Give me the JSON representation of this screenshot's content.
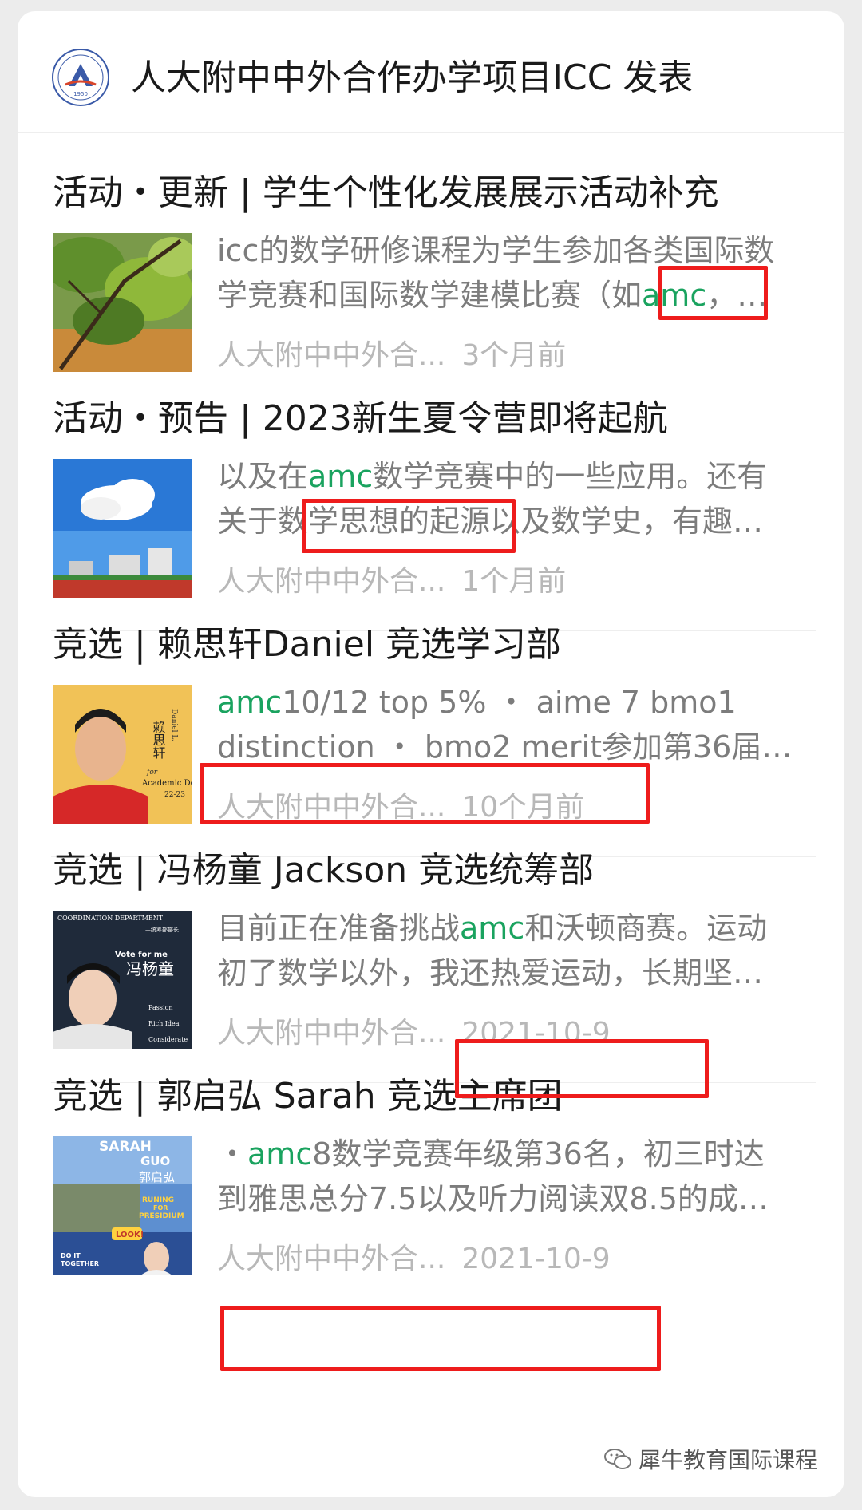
{
  "account": {
    "title": "人大附中中外合作办学项目ICC 发表",
    "logo_year": "1950"
  },
  "articles": [
    {
      "title": "活动・更新 | 学生个性化发展展示活动补充",
      "summary_lines": [
        {
          "pre": "icc的数学研修课程为学生参加各类国际数",
          "hl": "",
          "post": ""
        },
        {
          "pre": "学竞赛和国际数学建模比赛（如",
          "hl": "amc",
          "post": "，…"
        }
      ],
      "source": "人大附中中外合...",
      "time": "3个月前"
    },
    {
      "title": "活动・预告 | 2023新生夏令营即将起航",
      "summary_lines": [
        {
          "pre": "以及在",
          "hl": "amc",
          "post": "数学竞赛中的一些应用。还有"
        },
        {
          "pre": "关于数学思想的起源以及数学史，有趣…",
          "hl": "",
          "post": ""
        }
      ],
      "source": "人大附中中外合...",
      "time": "1个月前"
    },
    {
      "title": "竞选 | 赖思轩Daniel 竞选学习部",
      "summary_lines": [
        {
          "pre": "",
          "hl": "amc",
          "post": "10/12 top 5% ・ aime 7 bmo1"
        },
        {
          "pre": "distinction ・ bmo2 merit参加第36届…",
          "hl": "",
          "post": ""
        }
      ],
      "source": "人大附中中外合...",
      "time": "10个月前",
      "thumb_text": {
        "name": "赖思轩",
        "sign": "Daniel L.",
        "for": "for",
        "dept": "Academic Dept.",
        "year": "22-23"
      }
    },
    {
      "title": "竞选 | 冯杨童 Jackson 竞选统筹部",
      "summary_lines": [
        {
          "pre": "目前正在准备挑战",
          "hl": "amc",
          "post": "和沃顿商赛。运动"
        },
        {
          "pre": "初了数学以外，我还热爱运动，长期坚…",
          "hl": "",
          "post": ""
        }
      ],
      "source": "人大附中中外合...",
      "time": "2021-10-9",
      "thumb_text": {
        "dept": "COORDINATION DEPARTMENT",
        "role": "—统筹部部长",
        "vote": "Vote for me",
        "name": "冯杨童",
        "w1": "Passion",
        "w2": "Rich Idea",
        "w3": "Considerate"
      }
    },
    {
      "title": "竞选 | 郭启弘 Sarah 竞选主席团",
      "summary_lines": [
        {
          "pre": "・",
          "hl": "amc",
          "post": "8数学竞赛年级第36名，初三时达"
        },
        {
          "pre": "到雅思总分7.5以及听力阅读双8.5的成…",
          "hl": "",
          "post": ""
        }
      ],
      "source": "人大附中中外合...",
      "time": "2021-10-9",
      "thumb_text": {
        "n1": "SARAH",
        "n2": "GUO",
        "cn": "郭启弘",
        "r1": "RUNING",
        "r2": "FOR",
        "r3": "PRESIDIUM",
        "look": "LOOK!",
        "d1": "DO IT",
        "d2": "TOGETHER"
      }
    }
  ],
  "watermark": "犀牛教育国际课程",
  "colors": {
    "highlight": "#1aa35f",
    "annotation": "#ee1c1c",
    "meta": "#b8b8b8",
    "summary": "#7c7c7c"
  }
}
